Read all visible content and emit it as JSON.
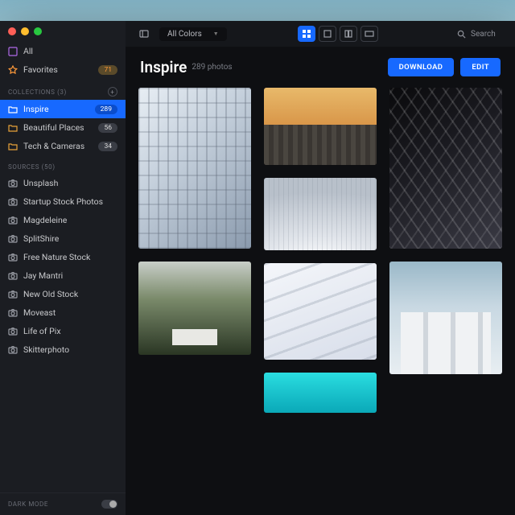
{
  "sidebar": {
    "all_label": "All",
    "favorites_label": "Favorites",
    "favorites_count": "71",
    "collections_header": "COLLECTIONS (3)",
    "collections": [
      {
        "label": "Inspire",
        "count": "289",
        "active": true
      },
      {
        "label": "Beautiful Places",
        "count": "56"
      },
      {
        "label": "Tech & Cameras",
        "count": "34"
      }
    ],
    "sources_header": "SOURCES (50)",
    "sources": [
      {
        "label": "Unsplash"
      },
      {
        "label": "Startup Stock Photos"
      },
      {
        "label": "Magdeleine"
      },
      {
        "label": "SplitShire"
      },
      {
        "label": "Free Nature Stock"
      },
      {
        "label": "Jay Mantri"
      },
      {
        "label": "New Old Stock"
      },
      {
        "label": "Moveast"
      },
      {
        "label": "Life of Pix"
      },
      {
        "label": "Skitterphoto"
      }
    ],
    "darkmode_label": "DARK MODE"
  },
  "toolbar": {
    "colors_label": "All Colors",
    "search_placeholder": "Search"
  },
  "header": {
    "title": "Inspire",
    "subtitle": "289 photos",
    "download_label": "DOWNLOAD",
    "edit_label": "EDIT"
  },
  "colors": {
    "accent": "#1769ff"
  }
}
